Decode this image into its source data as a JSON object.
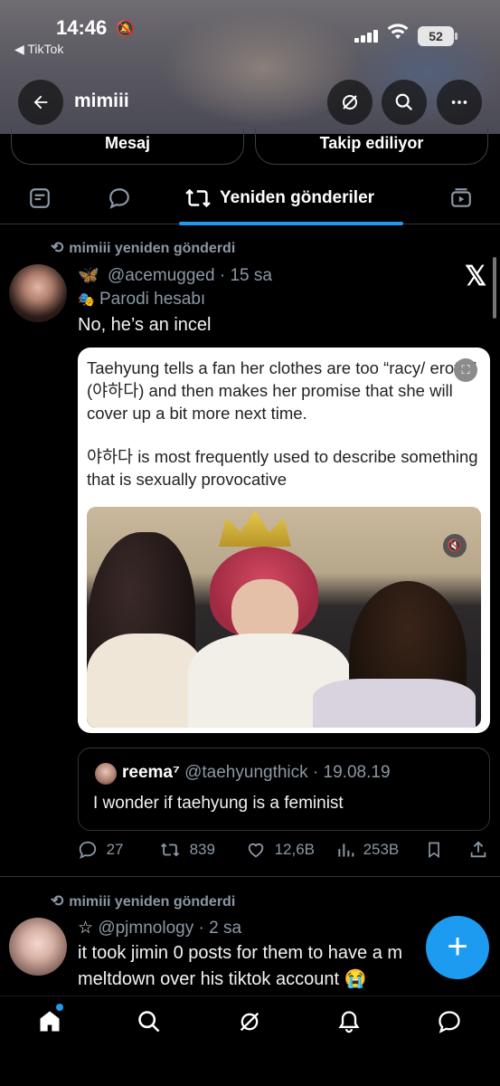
{
  "status_bar": {
    "time": "14:46",
    "back_app": "◀ TikTok",
    "battery": "52"
  },
  "header": {
    "title": "mimiii"
  },
  "profile_buttons": {
    "message": "Mesaj",
    "following": "Takip ediliyor"
  },
  "tabs": {
    "active_label": "Yeniden gönderiler"
  },
  "posts": [
    {
      "repost_label": "mimiii yeniden gönderdi",
      "author_emoji": "🦋",
      "handle": "@acemugged",
      "time": "15 sa",
      "badge_emoji": "🎭",
      "badge": "Parodi hesabı",
      "text": "No, he’s an incel",
      "card": {
        "paragraph1": "Taehyung tells a fan her clothes are too “racy/ erotic” (야하다) and then makes her promise that she will cover up a bit more next time.",
        "paragraph2": "야하다 is most frequently used to describe something that is sexually provocative"
      },
      "quoted": {
        "name": "reema⁷",
        "handle": "@taehyungthick",
        "date": "19.08.19",
        "text": "I wonder if taehyung is a feminist"
      },
      "stats": {
        "replies": "27",
        "reposts": "839",
        "likes": "12,6B",
        "views": "253B"
      }
    },
    {
      "repost_label": "mimiii yeniden gönderdi",
      "author_emoji": "☆",
      "handle": "@pjmnology",
      "time": "2 sa",
      "text_line1": "it took jimin 0 posts for them to have a m",
      "text_line2": "meltdown over his tiktok account 😭"
    }
  ],
  "colors": {
    "accent": "#1d9bf0",
    "background": "#000000",
    "secondary_text": "#8b98a5"
  },
  "icons": [
    "back-arrow-icon",
    "grok-icon",
    "search-icon",
    "more-icon",
    "repost-icon",
    "x-logo-icon",
    "reply-icon",
    "like-icon",
    "views-icon",
    "bookmark-icon",
    "share-icon",
    "home-icon",
    "bell-icon",
    "messages-icon",
    "compose-icon"
  ]
}
